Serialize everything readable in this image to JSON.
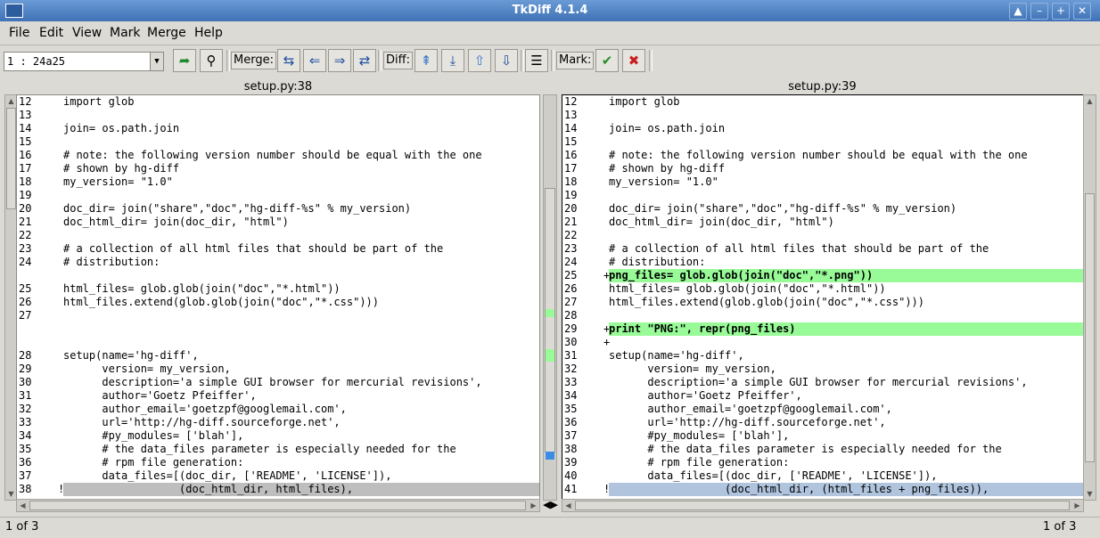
{
  "window": {
    "title": "TkDiff 4.1.4"
  },
  "menu": {
    "items": [
      "File",
      "Edit",
      "View",
      "Mark",
      "Merge",
      "Help"
    ]
  },
  "toolbar": {
    "combo_value": "1     : 24a25",
    "merge_label": "Merge:",
    "diff_label": "Diff:",
    "mark_label": "Mark:"
  },
  "left": {
    "title": "setup.py:38",
    "lines": [
      {
        "n": "12",
        "t": "import glob"
      },
      {
        "n": "13",
        "t": ""
      },
      {
        "n": "14",
        "t": "join= os.path.join"
      },
      {
        "n": "15",
        "t": ""
      },
      {
        "n": "16",
        "t": "# note: the following version number should be equal with the one"
      },
      {
        "n": "17",
        "t": "# shown by hg-diff"
      },
      {
        "n": "18",
        "t": "my_version= \"1.0\""
      },
      {
        "n": "19",
        "t": ""
      },
      {
        "n": "20",
        "t": "doc_dir= join(\"share\",\"doc\",\"hg-diff-%s\" % my_version)"
      },
      {
        "n": "21",
        "t": "doc_html_dir= join(doc_dir, \"html\")"
      },
      {
        "n": "22",
        "t": ""
      },
      {
        "n": "23",
        "t": "# a collection of all html files that should be part of the"
      },
      {
        "n": "24",
        "t": "# distribution:"
      },
      {
        "n": "",
        "t": "",
        "bg": "#f0e68c"
      },
      {
        "n": "25",
        "t": "html_files= glob.glob(join(\"doc\",\"*.html\"))"
      },
      {
        "n": "26",
        "t": "html_files.extend(glob.glob(join(\"doc\",\"*.css\")))"
      },
      {
        "n": "27",
        "t": ""
      },
      {
        "n": "",
        "t": "",
        "bg": "#bebebe"
      },
      {
        "n": "",
        "t": "",
        "bg": "#bebebe"
      },
      {
        "n": "28",
        "t": "setup(name='hg-diff',"
      },
      {
        "n": "29",
        "t": "      version= my_version,"
      },
      {
        "n": "30",
        "t": "      description='a simple GUI browser for mercurial revisions',"
      },
      {
        "n": "31",
        "t": "      author='Goetz Pfeiffer',"
      },
      {
        "n": "32",
        "t": "      author_email='goetzpf@googlemail.com',"
      },
      {
        "n": "33",
        "t": "      url='http://hg-diff.sourceforge.net',"
      },
      {
        "n": "34",
        "t": "      #py_modules= ['blah'],"
      },
      {
        "n": "35",
        "t": "      # the data_files parameter is especially needed for the"
      },
      {
        "n": "36",
        "t": "      # rpm file generation:"
      },
      {
        "n": "37",
        "t": "      data_files=[(doc_dir, ['README', 'LICENSE']),"
      },
      {
        "n": "38",
        "t": "                  (doc_html_dir, html_files),",
        "m": "!",
        "bg": "#bebebe"
      }
    ]
  },
  "right": {
    "title": "setup.py:39",
    "lines": [
      {
        "n": "12",
        "t": "import glob"
      },
      {
        "n": "13",
        "t": ""
      },
      {
        "n": "14",
        "t": "join= os.path.join"
      },
      {
        "n": "15",
        "t": ""
      },
      {
        "n": "16",
        "t": "# note: the following version number should be equal with the one"
      },
      {
        "n": "17",
        "t": "# shown by hg-diff"
      },
      {
        "n": "18",
        "t": "my_version= \"1.0\""
      },
      {
        "n": "19",
        "t": ""
      },
      {
        "n": "20",
        "t": "doc_dir= join(\"share\",\"doc\",\"hg-diff-%s\" % my_version)"
      },
      {
        "n": "21",
        "t": "doc_html_dir= join(doc_dir, \"html\")"
      },
      {
        "n": "22",
        "t": ""
      },
      {
        "n": "23",
        "t": "# a collection of all html files that should be part of the"
      },
      {
        "n": "24",
        "t": "# distribution:"
      },
      {
        "n": "25",
        "t": "png_files= glob.glob(join(\"doc\",\"*.png\"))",
        "m": "+",
        "bg": "#98fb98",
        "bold": true
      },
      {
        "n": "26",
        "t": "html_files= glob.glob(join(\"doc\",\"*.html\"))"
      },
      {
        "n": "27",
        "t": "html_files.extend(glob.glob(join(\"doc\",\"*.css\")))"
      },
      {
        "n": "28",
        "t": ""
      },
      {
        "n": "29",
        "t": "print \"PNG:\", repr(png_files)",
        "m": "+",
        "bg": "#98fb98",
        "bold": true
      },
      {
        "n": "30",
        "t": "",
        "m": "+",
        "bg": "#98fb98"
      },
      {
        "n": "31",
        "t": "setup(name='hg-diff',"
      },
      {
        "n": "32",
        "t": "      version= my_version,"
      },
      {
        "n": "33",
        "t": "      description='a simple GUI browser for mercurial revisions',"
      },
      {
        "n": "34",
        "t": "      author='Goetz Pfeiffer',"
      },
      {
        "n": "35",
        "t": "      author_email='goetzpf@googlemail.com',"
      },
      {
        "n": "36",
        "t": "      url='http://hg-diff.sourceforge.net',"
      },
      {
        "n": "37",
        "t": "      #py_modules= ['blah'],"
      },
      {
        "n": "38",
        "t": "      # the data_files parameter is especially needed for the"
      },
      {
        "n": "39",
        "t": "      # rpm file generation:"
      },
      {
        "n": "40",
        "t": "      data_files=[(doc_dir, ['README', 'LICENSE']),"
      },
      {
        "n": "41",
        "t": "                  (doc_html_dir, (html_files + png_files)),",
        "m": "!",
        "bg": "#b0c4de"
      }
    ]
  },
  "status": {
    "left": "1 of 3",
    "right": "1 of 3"
  },
  "colors": {
    "changed": "#bebebe",
    "added": "#98fb98",
    "placeholder": "#f0e68c",
    "current": "#b0c4de",
    "inline_hl": "#3c8ce6"
  }
}
